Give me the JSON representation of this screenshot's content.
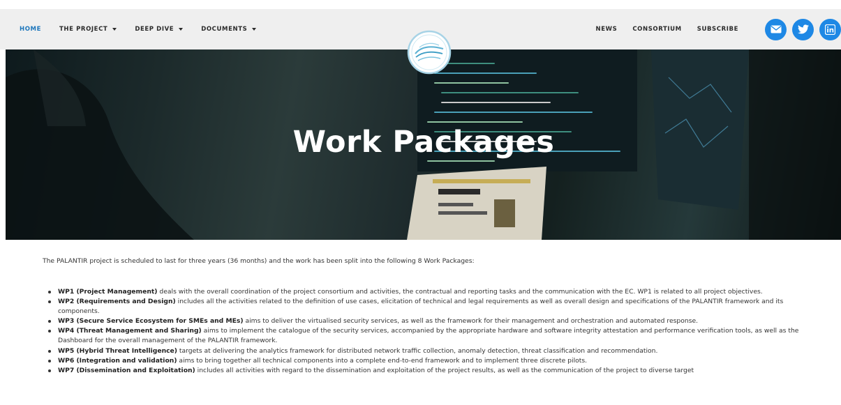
{
  "nav": {
    "left": [
      {
        "label": "HOME",
        "active": true,
        "dropdown": false
      },
      {
        "label": "THE PROJECT",
        "active": false,
        "dropdown": true
      },
      {
        "label": "DEEP DIVE",
        "active": false,
        "dropdown": true
      },
      {
        "label": "DOCUMENTS",
        "active": false,
        "dropdown": true
      }
    ],
    "right": [
      {
        "label": "NEWS"
      },
      {
        "label": "CONSORTIUM"
      },
      {
        "label": "SUBSCRIBE"
      }
    ],
    "social": [
      "email-icon",
      "twitter-icon",
      "linkedin-icon"
    ],
    "accent_color": "#1b75bb",
    "social_color": "#1e88e5"
  },
  "hero": {
    "title": "Work Packages"
  },
  "content": {
    "intro": "The PALANTIR project is scheduled to last for three years (36 months) and the work has been split into the following 8 Work Packages:",
    "work_packages": [
      {
        "name": "WP1 (Project Management)",
        "text": " deals with the overall coordination of the project consortium and activities, the contractual and reporting tasks and the communication with the EC. WP1 is related to all project objectives."
      },
      {
        "name": "WP2 (Requirements and Design)",
        "text": " includes all the activities related to the definition of use cases, elicitation of technical and legal requirements as well as overall design and specifications of the PALANTIR framework and its components."
      },
      {
        "name": "WP3 (Secure Service Ecosystem for SMEs and MEs)",
        "text": " aims to deliver the virtualised security services, as well as the framework for their management and orchestration and automated response."
      },
      {
        "name": "WP4 (Threat Management and Sharing)",
        "text": " aims to implement the catalogue of the security services, accompanied by the appropriate hardware and software integrity attestation and performance verification tools, as well as the Dashboard for the overall management of the PALANTIR framework."
      },
      {
        "name": "WP5 (Hybrid Threat Intelligence)",
        "text": " targets at delivering the analytics framework for distributed network traffic collection, anomaly detection, threat classification and recommendation."
      },
      {
        "name": "WP6 (Integration and validation)",
        "text": " aims to bring together all technical components into a complete end-to-end framework and to implement three discrete pilots."
      },
      {
        "name": "WP7 (Dissemination and Exploitation)",
        "text": " includes all activities with regard to the dissemination and exploitation of the project results, as well as the communication of the project to diverse target"
      }
    ]
  }
}
